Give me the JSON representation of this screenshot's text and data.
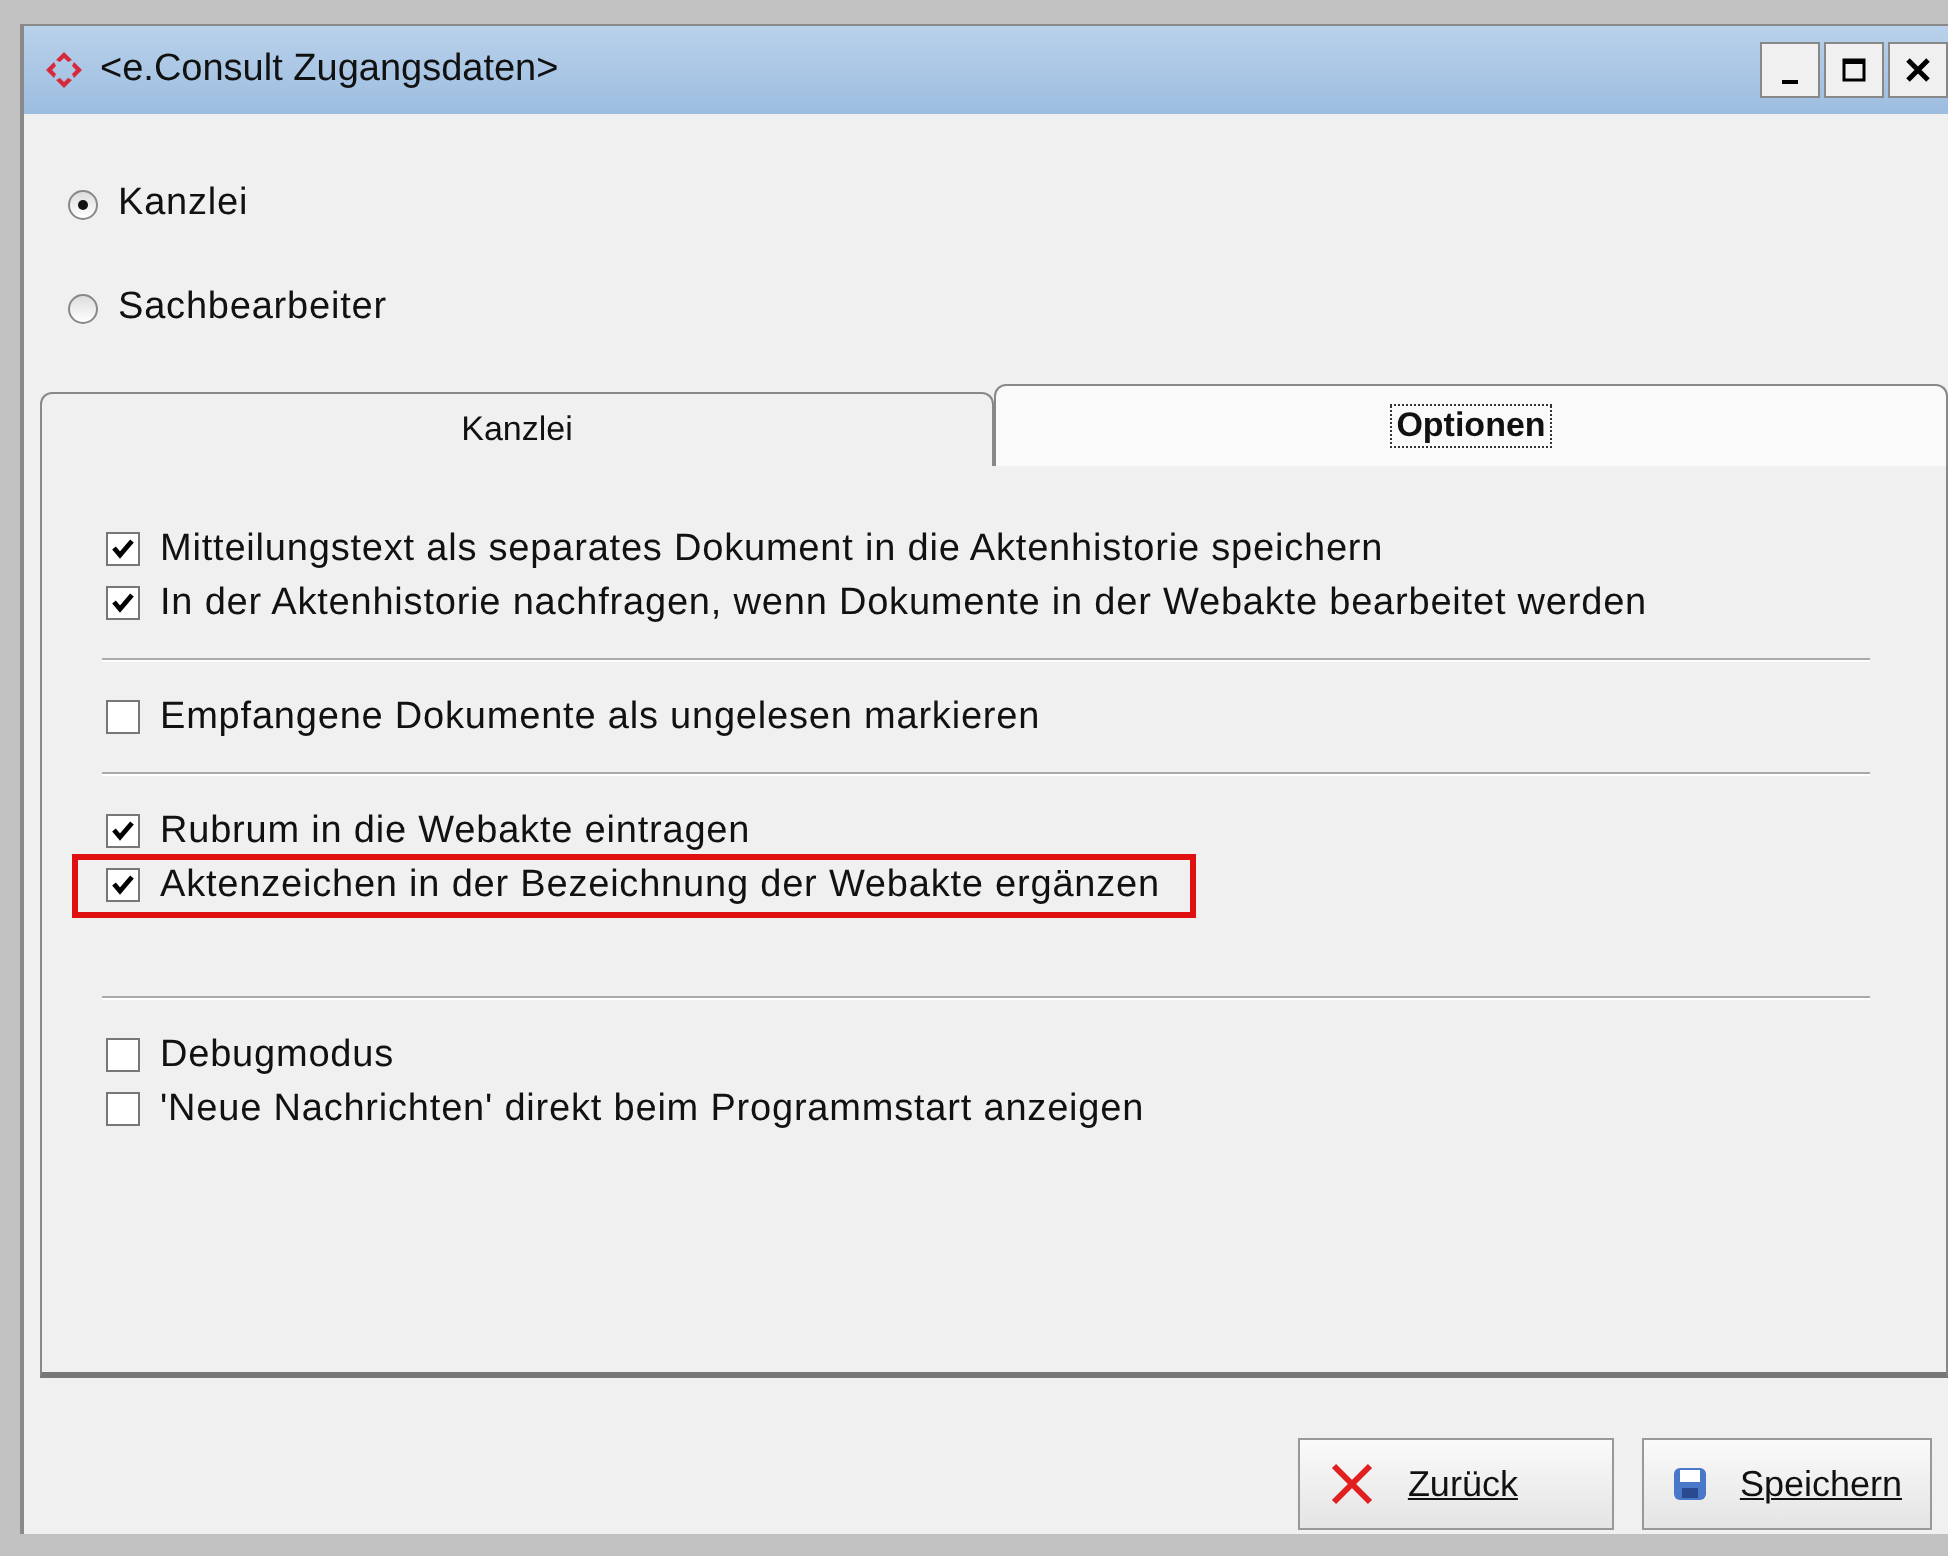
{
  "window": {
    "title": "<e.Consult Zugangsdaten>"
  },
  "radios": [
    {
      "label": "Kanzlei",
      "selected": true
    },
    {
      "label": "Sachbearbeiter",
      "selected": false
    }
  ],
  "tabs": [
    {
      "label": "Kanzlei",
      "selected": false
    },
    {
      "label": "Optionen",
      "selected": true
    }
  ],
  "option_groups": [
    {
      "options": [
        {
          "label": "Mitteilungstext als separates Dokument in die Aktenhistorie speichern",
          "checked": true,
          "highlighted": false
        },
        {
          "label": "In der Aktenhistorie nachfragen, wenn Dokumente in der Webakte bearbeitet werden",
          "checked": true,
          "highlighted": false
        }
      ]
    },
    {
      "options": [
        {
          "label": "Empfangene Dokumente als ungelesen markieren",
          "checked": false,
          "highlighted": false
        }
      ]
    },
    {
      "options": [
        {
          "label": "Rubrum in die Webakte eintragen",
          "checked": true,
          "highlighted": false
        },
        {
          "label": "Aktenzeichen in der Bezeichnung der Webakte ergänzen",
          "checked": true,
          "highlighted": true
        }
      ]
    },
    {
      "options": [
        {
          "label": "Debugmodus",
          "checked": false,
          "highlighted": false
        },
        {
          "label": "'Neue Nachrichten' direkt beim Programmstart anzeigen",
          "checked": false,
          "highlighted": false
        }
      ]
    }
  ],
  "buttons": [
    {
      "label": "Zurück",
      "kind": "cancel"
    },
    {
      "label": "Speichern",
      "kind": "save"
    }
  ]
}
